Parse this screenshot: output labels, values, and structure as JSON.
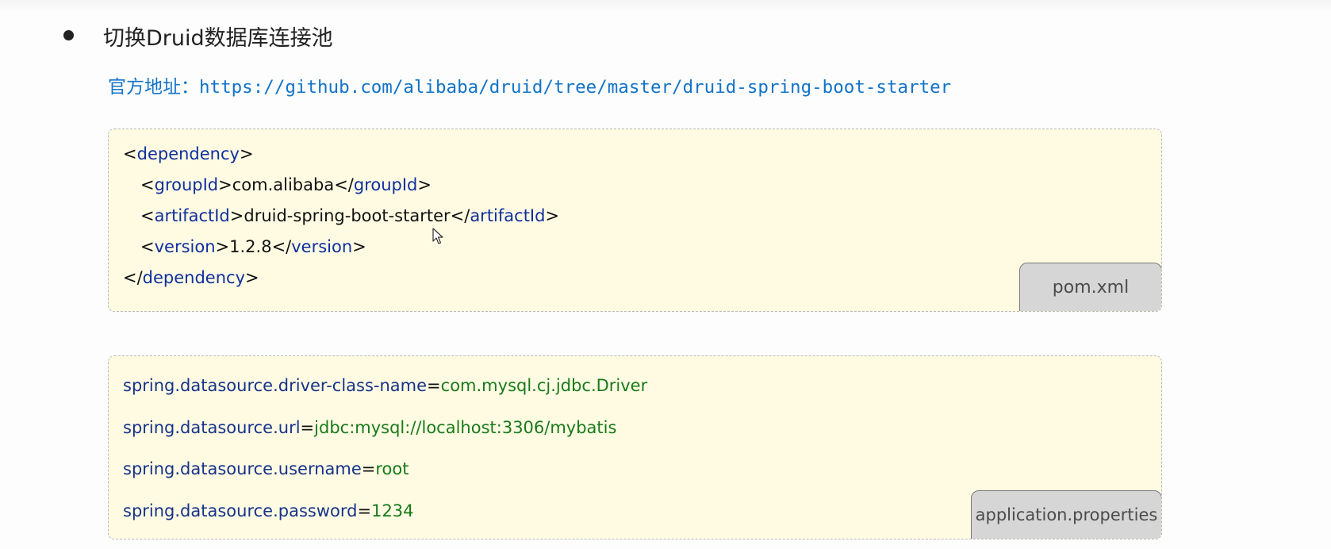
{
  "heading": {
    "text": "切换Druid数据库连接池"
  },
  "address": {
    "label": "官方地址：",
    "url": "https://github.com/alibaba/druid/tree/master/druid-spring-boot-starter"
  },
  "pom_block": {
    "file_label": "pom.xml",
    "dependency_open": "dependency",
    "group_tag": "groupId",
    "group_value": "com.alibaba",
    "artifact_tag": "artifactId",
    "artifact_value": "druid-spring-boot-starter",
    "version_tag": "version",
    "version_value": "1.2.8",
    "dependency_close": "dependency"
  },
  "properties_block": {
    "file_label": "application.properties",
    "entries": [
      {
        "key": "spring.datasource.driver-class-name",
        "value": "com.mysql.cj.jdbc.Driver"
      },
      {
        "key": "spring.datasource.url",
        "value": "jdbc:mysql://localhost:3306/mybatis"
      },
      {
        "key": "spring.datasource.username",
        "value": "root"
      },
      {
        "key": "spring.datasource.password",
        "value": "1234"
      }
    ]
  },
  "symbols": {
    "lt": "<",
    "gt": ">",
    "close_lt": "</",
    "eq": "="
  },
  "colors": {
    "url": "#1273c7",
    "tag": "#0f2f9e",
    "value": "#187a1a",
    "code_background": "#fffbe3",
    "file_tab_background": "#d6d6d6"
  },
  "icons": {
    "bullet": "bullet-icon",
    "cursor": "mouse-cursor-icon"
  }
}
